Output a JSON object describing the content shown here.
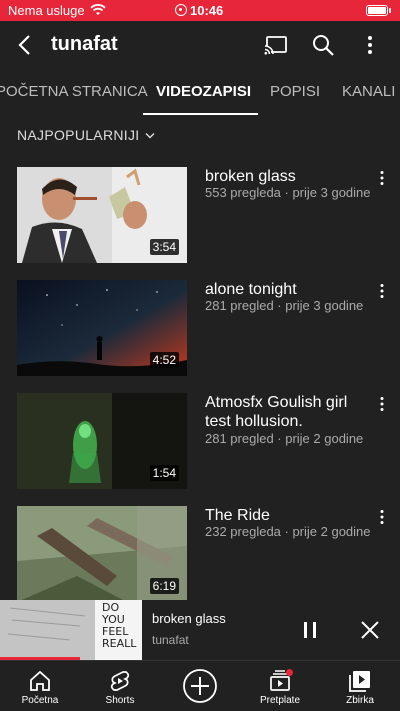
{
  "status_bar": {
    "carrier": "Nema usluge",
    "time": "10:46",
    "status_color": "#e8263a"
  },
  "header": {
    "channel_name": "tunafat",
    "icons": [
      "back-arrow-icon",
      "cast-icon",
      "search-icon",
      "more-vert-icon"
    ]
  },
  "tabs": [
    {
      "label": "POČETNA STRANICA",
      "active": false
    },
    {
      "label": "VIDEOZAPISI",
      "active": true
    },
    {
      "label": "POPISI",
      "active": false
    },
    {
      "label": "KANALI",
      "active": false
    }
  ],
  "sort": {
    "label": "NAJPOPULARNIJI"
  },
  "videos": [
    {
      "title": "broken glass",
      "views": "553 pregleda",
      "age": "prije 3 godine",
      "meta": "553 pregleda · prije 3 godine",
      "duration": "3:54"
    },
    {
      "title": "alone tonight",
      "views": "281 pregled",
      "age": "prije 3 godine",
      "meta": "281 pregled · prije 3 godine",
      "duration": "4:52"
    },
    {
      "title": "Atmosfx Goulish girl test hollusion.",
      "views": "281 pregled",
      "age": "prije 2 godine",
      "meta": "281 pregled · prije 2 godine",
      "duration": "1:54"
    },
    {
      "title": "The Ride",
      "views": "232 pregleda",
      "age": "prije 2 godine",
      "meta": "232 pregleda · prije 2 godine",
      "duration": "6:19"
    }
  ],
  "mini_player": {
    "title": "broken glass",
    "channel": "tunafat",
    "thumb_text": "DO YOU FEEL REALL",
    "progress": 0.2
  },
  "bottom_nav": [
    {
      "label": "Početna",
      "icon": "home-icon"
    },
    {
      "label": "Shorts",
      "icon": "shorts-icon"
    },
    {
      "label": "",
      "icon": "create-icon"
    },
    {
      "label": "Pretplate",
      "icon": "subscriptions-icon"
    },
    {
      "label": "Zbirka",
      "icon": "library-icon"
    }
  ]
}
